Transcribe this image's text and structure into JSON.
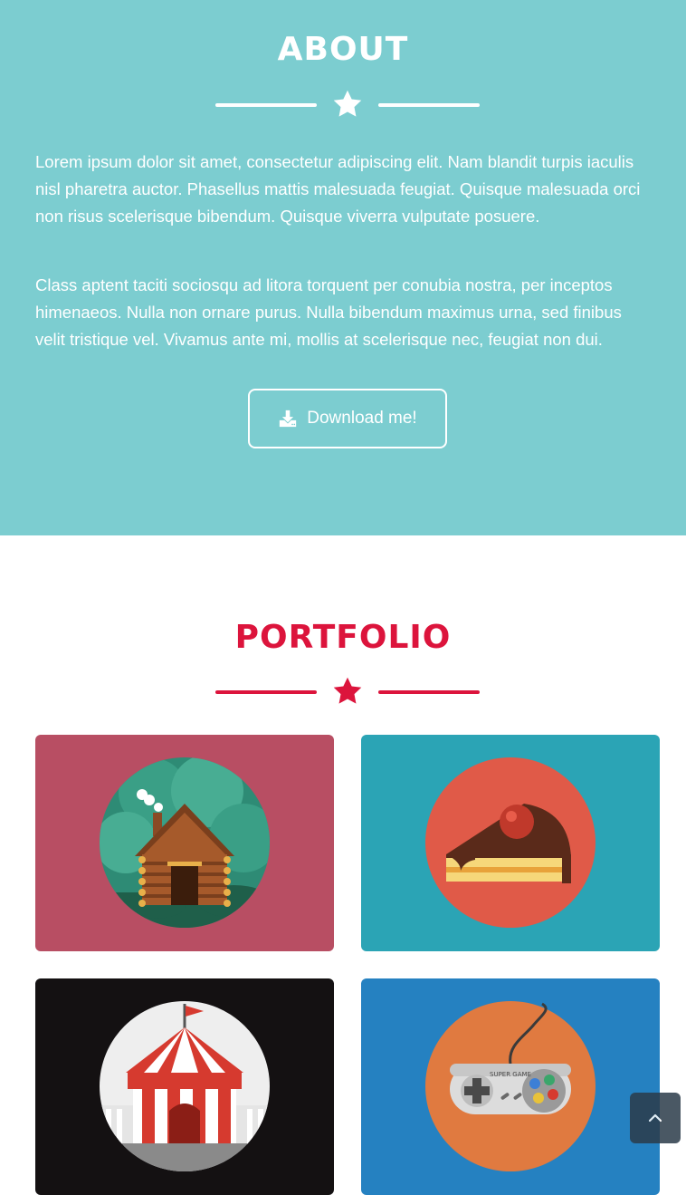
{
  "about": {
    "title": "ABOUT",
    "paragraph_1": "Lorem ipsum dolor sit amet, consectetur adipiscing elit. Nam blandit turpis iaculis nisl pharetra auctor. Phasellus mattis malesuada feugiat. Quisque malesuada orci non risus scelerisque bibendum. Quisque viverra vulputate posuere.",
    "paragraph_2": "Class aptent taciti sociosqu ad litora torquent per conubia nostra, per inceptos himenaeos. Nulla non ornare purus. Nulla bibendum maximus urna, sed finibus velit tristique vel. Vivamus ante mi, mollis at scelerisque nec, feugiat non dui.",
    "download_label": "Download me!",
    "icon": "download-icon",
    "background_color": "#7ccdd0"
  },
  "portfolio": {
    "title": "PORTFOLIO",
    "accent_color": "#dc143c",
    "items": [
      {
        "name": "cabin",
        "background_color": "#b84e63"
      },
      {
        "name": "cake",
        "background_color": "#2ba4b5"
      },
      {
        "name": "circus-tent",
        "background_color": "#141112"
      },
      {
        "name": "game-controller",
        "label": "SUPER GAME",
        "background_color": "#2581c1"
      }
    ]
  },
  "scroll_top": {
    "icon": "chevron-up-icon"
  }
}
